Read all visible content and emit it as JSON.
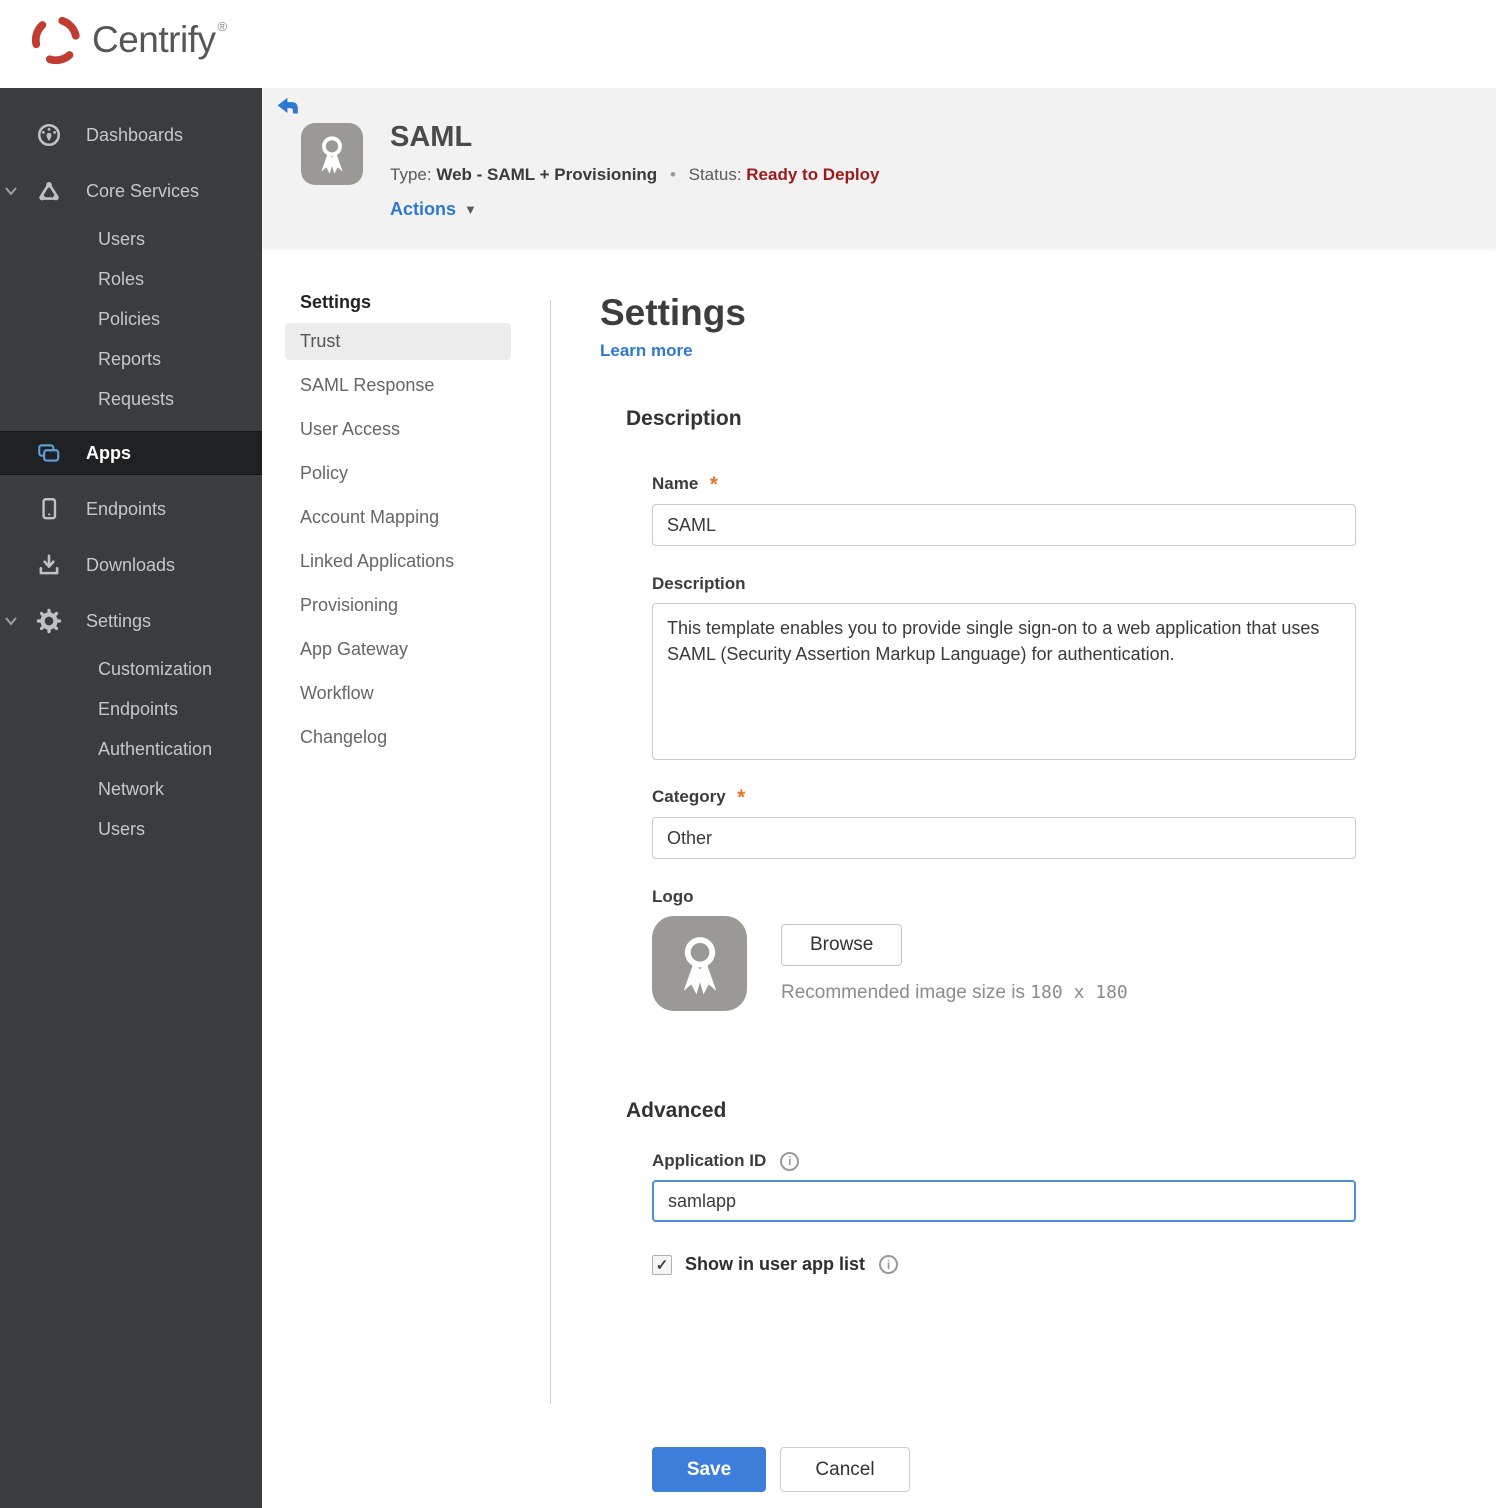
{
  "brand": {
    "name": "Centrify",
    "registered": "®"
  },
  "colors": {
    "accent_blue": "#2e78d2",
    "save_blue": "#3d7edb",
    "apps_icon_blue": "#5b9fd9",
    "status_red": "#9e1a1a",
    "required_orange": "#e8772e",
    "sidebar_bg": "#3a3c3e",
    "sidebar_active_bg": "#1f2123",
    "header_bg": "#f2f2f3"
  },
  "sidebar": {
    "items": [
      {
        "label": "Dashboards",
        "icon": "dashboard-icon",
        "level": 0
      },
      {
        "label": "Core Services",
        "icon": "core-services-icon",
        "level": 0,
        "expanded": true
      },
      {
        "label": "Users",
        "level": 1
      },
      {
        "label": "Roles",
        "level": 1
      },
      {
        "label": "Policies",
        "level": 1
      },
      {
        "label": "Reports",
        "level": 1
      },
      {
        "label": "Requests",
        "level": 1
      },
      {
        "label": "Apps",
        "icon": "apps-icon",
        "level": 0,
        "active": true
      },
      {
        "label": "Endpoints",
        "icon": "endpoints-icon",
        "level": 0
      },
      {
        "label": "Downloads",
        "icon": "downloads-icon",
        "level": 0
      },
      {
        "label": "Settings",
        "icon": "settings-icon",
        "level": 0,
        "expanded": true
      },
      {
        "label": "Customization",
        "level": 1
      },
      {
        "label": "Endpoints",
        "level": 1
      },
      {
        "label": "Authentication",
        "level": 1
      },
      {
        "label": "Network",
        "level": 1
      },
      {
        "label": "Users",
        "level": 1
      }
    ]
  },
  "header": {
    "title": "SAML",
    "type_label": "Type:",
    "type_value": "Web - SAML + Provisioning",
    "separator": "•",
    "status_label": "Status:",
    "status_value": "Ready to Deploy",
    "actions_label": "Actions",
    "actions_caret": "▼"
  },
  "subnav": {
    "header": "Settings",
    "items": [
      {
        "label": "Trust",
        "active": true
      },
      {
        "label": "SAML Response"
      },
      {
        "label": "User Access"
      },
      {
        "label": "Policy"
      },
      {
        "label": "Account Mapping"
      },
      {
        "label": "Linked Applications"
      },
      {
        "label": "Provisioning"
      },
      {
        "label": "App Gateway"
      },
      {
        "label": "Workflow"
      },
      {
        "label": "Changelog"
      }
    ]
  },
  "main": {
    "title": "Settings",
    "learn_more": "Learn more",
    "description": {
      "heading": "Description",
      "required_marker": "*",
      "name_label": "Name",
      "name_value": "SAML",
      "desc_label": "Description",
      "desc_value": "This template enables you to provide single sign-on to a web application that uses SAML (Security Assertion Markup Language) for authentication.",
      "category_label": "Category",
      "category_value": "Other",
      "logo_label": "Logo",
      "browse_label": "Browse",
      "recommended_prefix": "Recommended image size is ",
      "recommended_size": "180 x 180"
    },
    "advanced": {
      "heading": "Advanced",
      "app_id_label": "Application ID",
      "app_id_value": "samlapp",
      "info_glyph": "i",
      "show_label": "Show in user app list",
      "checked": true,
      "check_glyph": "✓"
    },
    "buttons": {
      "save": "Save",
      "cancel": "Cancel"
    }
  }
}
